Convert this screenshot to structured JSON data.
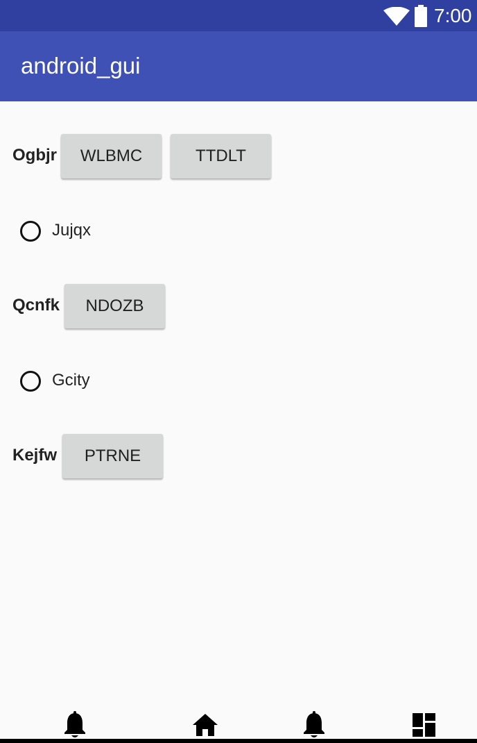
{
  "status_bar": {
    "time": "7:00",
    "icons": [
      "wifi-icon",
      "battery-icon"
    ]
  },
  "app_bar": {
    "title": "android_gui"
  },
  "content": {
    "row1": {
      "label": "Ogbjr",
      "buttons": [
        "WLBMC",
        "TTDLT"
      ]
    },
    "radio1": {
      "label": "Jujqx",
      "checked": false
    },
    "row2": {
      "label": "Qcnfk",
      "buttons": [
        "NDOZB"
      ]
    },
    "radio2": {
      "label": "Gcity",
      "checked": false
    },
    "row3": {
      "label": "Kejfw",
      "buttons": [
        "PTRNE"
      ]
    }
  },
  "bottom_nav": {
    "icons": [
      "bell-icon",
      "home-icon",
      "bell-icon",
      "dashboard-icon"
    ]
  },
  "colors": {
    "status_bar": "#3040a0",
    "app_bar": "#3f51b5",
    "background": "#fafafa",
    "button": "#d6d7d7"
  }
}
